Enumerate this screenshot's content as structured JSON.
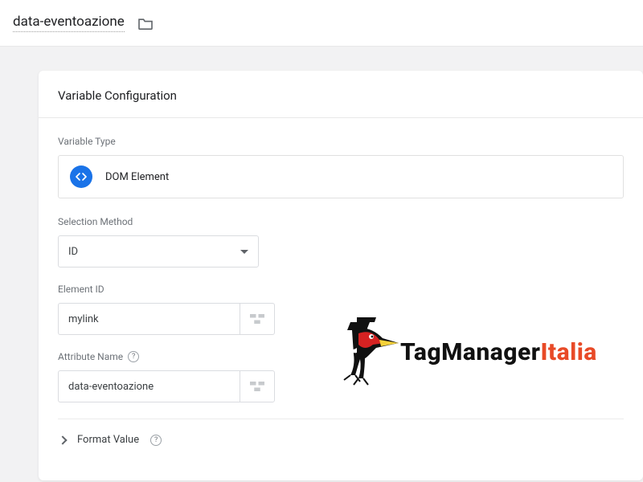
{
  "header": {
    "variable_name": "data-eventoazione"
  },
  "card": {
    "title": "Variable Configuration",
    "variable_type_label": "Variable Type",
    "variable_type_value": "DOM Element",
    "selection_method_label": "Selection Method",
    "selection_method_value": "ID",
    "element_id_label": "Element ID",
    "element_id_value": "mylink",
    "attribute_name_label": "Attribute Name",
    "attribute_name_value": "data-eventoazione",
    "format_value_label": "Format Value"
  },
  "brand": {
    "part1": "TagManager",
    "part2": "Italia"
  }
}
